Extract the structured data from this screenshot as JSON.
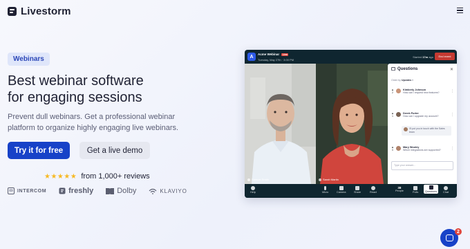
{
  "header": {
    "brand": "Livestorm",
    "menu_icon": "hamburger-icon"
  },
  "hero": {
    "badge": "Webinars",
    "title_line1": "Best webinar software",
    "title_line2": "for engaging sessions",
    "subtitle_line1": "Prevent dull webinars. Get a professional webinar",
    "subtitle_line2": "platform to organize highly engaging live webinars.",
    "cta_primary": "Try it for free",
    "cta_secondary": "Get a live demo",
    "stars": "★★★★★",
    "reviews": "from 1,000+ reviews",
    "rating_stars": 5
  },
  "logos": [
    {
      "name": "INTERCOM",
      "icon": "intercom-icon"
    },
    {
      "name": "freshly",
      "icon": "freshly-icon"
    },
    {
      "name": "Dolby",
      "icon": "dolby-icon"
    },
    {
      "name": "KLAVIYO",
      "icon": "klaviyo-icon"
    }
  ],
  "app": {
    "title": "Acme Webinar",
    "live": "Live",
    "date": "Tuesday, May 27th  ·  3:00 PM",
    "started_label": "Started",
    "started_time": "17m",
    "started_suffix": "ago",
    "end_button": "End event",
    "video1_label": "Samuel Smith",
    "video2_label": "Sarah Martin",
    "questions": {
      "title": "Questions",
      "order_label": "Order by",
      "order_value": "Upvotes",
      "items": [
        {
          "votes": "2",
          "name": "Kimberly Johnson",
          "text": "How can I request new features?"
        },
        {
          "votes": "1",
          "name": "Derek Porter",
          "text": "How can I upgrade my account?"
        },
        {
          "votes": "0",
          "name": "Mary Wooley",
          "text": "Which integrations are supported?"
        }
      ],
      "reply": "I'll put you in touch with the Sales team",
      "input_placeholder": "Type your answer..."
    },
    "toolbar": {
      "help": "Help",
      "micro": "Micro",
      "camera": "Camera",
      "share": "Share",
      "react": "React",
      "people_count": "38",
      "people": "People",
      "polls": "Polls",
      "questions": "Questions",
      "chat": "Chat"
    }
  },
  "chat_widget": {
    "badge": "2"
  },
  "colors": {
    "primary": "#1742c8",
    "star": "#f7b924",
    "live": "#e0443b",
    "app_bg": "#0f2630"
  }
}
